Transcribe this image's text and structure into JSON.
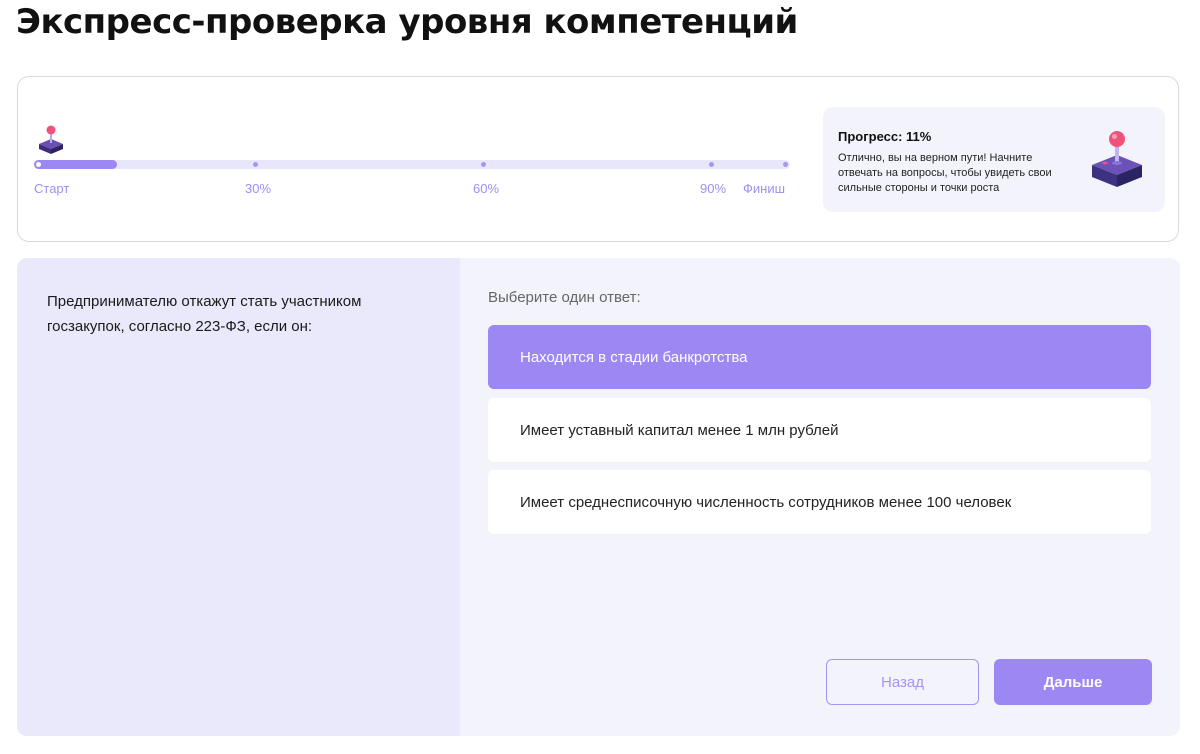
{
  "page": {
    "title": "Экспресс-проверка уровня компетенций"
  },
  "progress": {
    "value_percent": 11,
    "track_labels": {
      "start": "Старт",
      "p30": "30%",
      "p60": "60%",
      "p90": "90%",
      "finish": "Финиш"
    },
    "info_title": "Прогресс: 11%",
    "info_text": "Отлично, вы на верном пути! Начните отвечать на вопросы, чтобы увидеть свои сильные стороны и точки роста",
    "marker_icon": "joystick-icon"
  },
  "question": {
    "text": "Предпринимателю откажут стать участником госзакупок, согласно 223-ФЗ, если он:",
    "answers_label": "Выберите один ответ:",
    "answers": [
      {
        "label": "Находится в стадии банкротства",
        "selected": true
      },
      {
        "label": "Имеет уставный капитал менее 1 млн рублей",
        "selected": false
      },
      {
        "label": "Имеет среднесписочную численность сотрудников менее 100 человек",
        "selected": false
      }
    ]
  },
  "nav": {
    "back_label": "Назад",
    "next_label": "Дальше"
  },
  "colors": {
    "accent": "#9c87f3",
    "track": "#e8e6fb",
    "panel_bg": "#f3f3fc",
    "panel_left_bg": "#e9e9fb"
  }
}
